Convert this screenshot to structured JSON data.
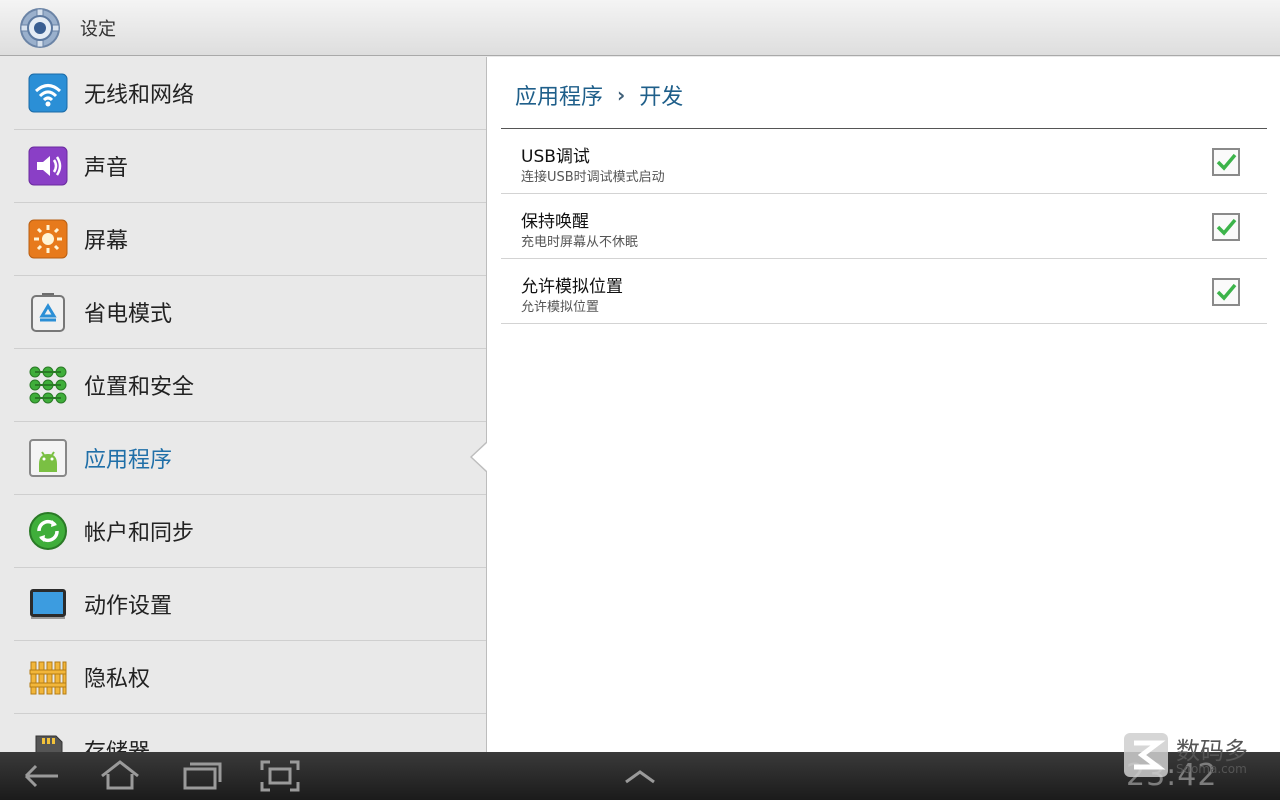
{
  "header": {
    "title": "设定",
    "icon": "gear-icon"
  },
  "sidebar": {
    "items": [
      {
        "label": "无线和网络",
        "icon": "wifi-icon"
      },
      {
        "label": "声音",
        "icon": "speaker-icon"
      },
      {
        "label": "屏幕",
        "icon": "brightness-icon"
      },
      {
        "label": "省电模式",
        "icon": "battery-recycle-icon"
      },
      {
        "label": "位置和安全",
        "icon": "dot-grid-icon"
      },
      {
        "label": "应用程序",
        "icon": "android-icon",
        "selected": true
      },
      {
        "label": "帐户和同步",
        "icon": "sync-icon"
      },
      {
        "label": "动作设置",
        "icon": "tablet-motion-icon"
      },
      {
        "label": "隐私权",
        "icon": "fence-icon"
      },
      {
        "label": "存储器",
        "icon": "sd-card-icon"
      }
    ]
  },
  "detail": {
    "breadcrumb": [
      "应用程序",
      "开发"
    ],
    "breadcrumb_separator": "›",
    "prefs": [
      {
        "title": "USB调试",
        "summary": "连接USB时调试模式启动",
        "checked": true
      },
      {
        "title": "保持唤醒",
        "summary": "充电时屏幕从不休眠",
        "checked": true
      },
      {
        "title": "允许模拟位置",
        "summary": "允许模拟位置",
        "checked": true
      }
    ]
  },
  "system_bar": {
    "clock": "23:42",
    "buttons": [
      "back-icon",
      "home-icon",
      "recent-apps-icon",
      "screenshot-icon",
      "expand-up-icon"
    ]
  },
  "watermark": {
    "text": "数码多",
    "sub": "Sooma.com"
  },
  "colors": {
    "accent": "#1f6fa8",
    "check": "#3cb44a",
    "system_bar": "#2a2a2a"
  }
}
